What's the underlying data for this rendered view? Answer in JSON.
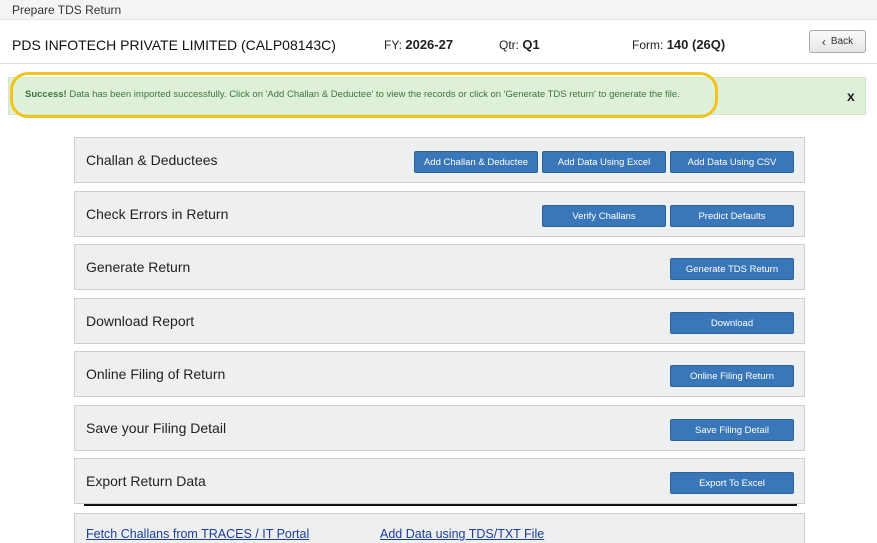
{
  "window": {
    "title": "Prepare TDS Return"
  },
  "header": {
    "company": "PDS INFOTECH PRIVATE LIMITED (CALP08143C)",
    "fy_label": "FY:",
    "fy_value": "2026-27",
    "qtr_label": "Qtr:",
    "qtr_value": "Q1",
    "form_label": "Form:",
    "form_value": "140 (26Q)",
    "back_label": "Back"
  },
  "alert": {
    "strong": "Success!",
    "message": " Data has been imported successfully. Click on 'Add Challan & Deductee' to view the records or click on 'Generate TDS return' to generate the file.",
    "close": "x"
  },
  "sections": [
    {
      "title": "Challan & Deductees",
      "buttons": [
        "Add Challan & Deductee",
        "Add Data Using Excel",
        "Add Data Using CSV"
      ]
    },
    {
      "title": "Check Errors in Return",
      "buttons": [
        "Verify Challans",
        "Predict Defaults"
      ]
    },
    {
      "title": "Generate Return",
      "buttons": [
        "Generate TDS Return"
      ]
    },
    {
      "title": "Download Report",
      "buttons": [
        "Download"
      ]
    },
    {
      "title": "Online Filing of Return",
      "buttons": [
        "Online Filing Return"
      ]
    },
    {
      "title": "Save your Filing Detail",
      "buttons": [
        "Save Filing Detail"
      ]
    },
    {
      "title": "Export Return Data",
      "buttons": [
        "Export To Excel"
      ]
    }
  ],
  "links": [
    "Fetch Challans from TRACES / IT Portal",
    "Add Data using TDS/TXT File"
  ],
  "colors": {
    "button": "#3a77b8",
    "alert_bg": "#dff0d8",
    "alert_text": "#3c763d",
    "highlight": "#f2c21d"
  }
}
